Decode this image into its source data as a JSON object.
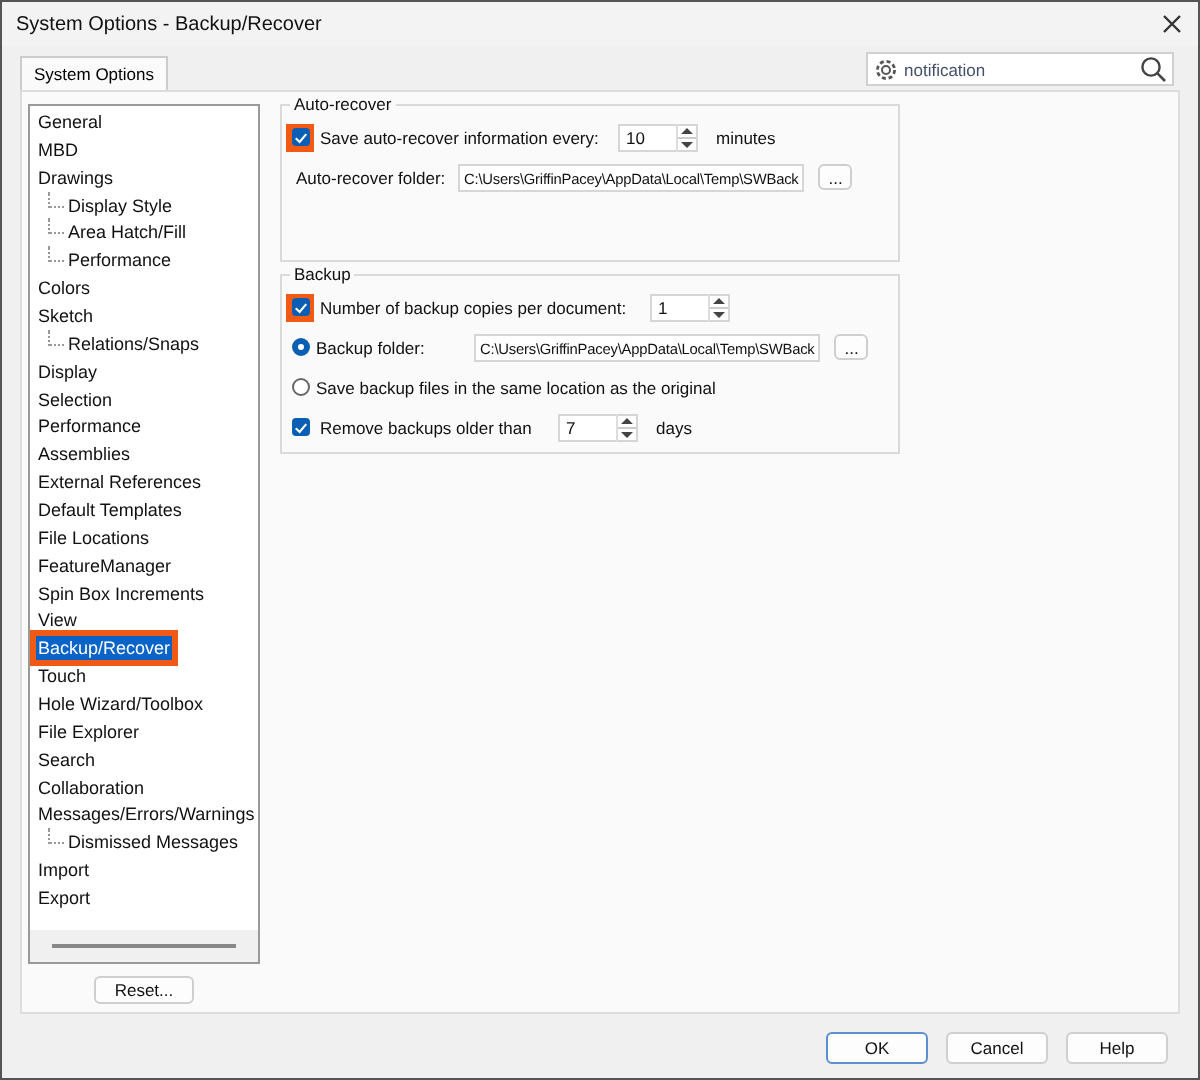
{
  "window": {
    "title": "System Options - Backup/Recover"
  },
  "tabs": [
    {
      "label": "System Options",
      "selected": true
    }
  ],
  "search": {
    "value": "notification"
  },
  "tree": [
    {
      "label": "General",
      "selected": false
    },
    {
      "label": "MBD",
      "selected": false
    },
    {
      "label": "Drawings",
      "selected": false,
      "children": [
        {
          "label": "Display Style",
          "selected": false
        },
        {
          "label": "Area Hatch/Fill",
          "selected": false
        },
        {
          "label": "Performance",
          "selected": false
        }
      ]
    },
    {
      "label": "Colors",
      "selected": false
    },
    {
      "label": "Sketch",
      "selected": false,
      "children": [
        {
          "label": "Relations/Snaps",
          "selected": false
        }
      ]
    },
    {
      "label": "Display",
      "selected": false
    },
    {
      "label": "Selection",
      "selected": false
    },
    {
      "label": "Performance",
      "selected": false
    },
    {
      "label": "Assemblies",
      "selected": false
    },
    {
      "label": "External References",
      "selected": false
    },
    {
      "label": "Default Templates",
      "selected": false
    },
    {
      "label": "File Locations",
      "selected": false
    },
    {
      "label": "FeatureManager",
      "selected": false
    },
    {
      "label": "Spin Box Increments",
      "selected": false
    },
    {
      "label": "View",
      "selected": false
    },
    {
      "label": "Backup/Recover",
      "selected": true
    },
    {
      "label": "Touch",
      "selected": false
    },
    {
      "label": "Hole Wizard/Toolbox",
      "selected": false
    },
    {
      "label": "File Explorer",
      "selected": false
    },
    {
      "label": "Search",
      "selected": false
    },
    {
      "label": "Collaboration",
      "selected": false
    },
    {
      "label": "Messages/Errors/Warnings",
      "selected": false,
      "children": [
        {
          "label": "Dismissed Messages",
          "selected": false
        }
      ]
    },
    {
      "label": "Import",
      "selected": false
    },
    {
      "label": "Export",
      "selected": false
    }
  ],
  "reset_button": "Reset...",
  "groups": [
    {
      "title": "Auto-recover",
      "rows": [
        {
          "kind": "check_spin",
          "label": "Save auto-recover information every:",
          "checked": true,
          "highlighted": true,
          "value": "10",
          "unit": "minutes"
        },
        {
          "kind": "folder",
          "label": "Auto-recover folder:",
          "value": "C:\\Users\\GriffinPacey\\AppData\\Local\\Temp\\SWBack",
          "button": "..."
        }
      ]
    },
    {
      "title": "Backup",
      "rows": [
        {
          "kind": "check_spin",
          "label": "Number of backup copies per document:",
          "checked": true,
          "highlighted": true,
          "value": "1"
        },
        {
          "kind": "radio_folder",
          "label": "Backup folder:",
          "selected": true,
          "value": "C:\\Users\\GriffinPacey\\AppData\\Local\\Temp\\SWBack",
          "button": "..."
        },
        {
          "kind": "radio",
          "label": "Save backup files in the same location as the original",
          "selected": false
        },
        {
          "kind": "check_spin",
          "label": "Remove backups older than",
          "checked": true,
          "highlighted": false,
          "value": "7",
          "unit": "days"
        }
      ]
    }
  ],
  "buttons": [
    {
      "label": "OK",
      "default": true
    },
    {
      "label": "Cancel",
      "default": false
    },
    {
      "label": "Help",
      "default": false
    }
  ]
}
